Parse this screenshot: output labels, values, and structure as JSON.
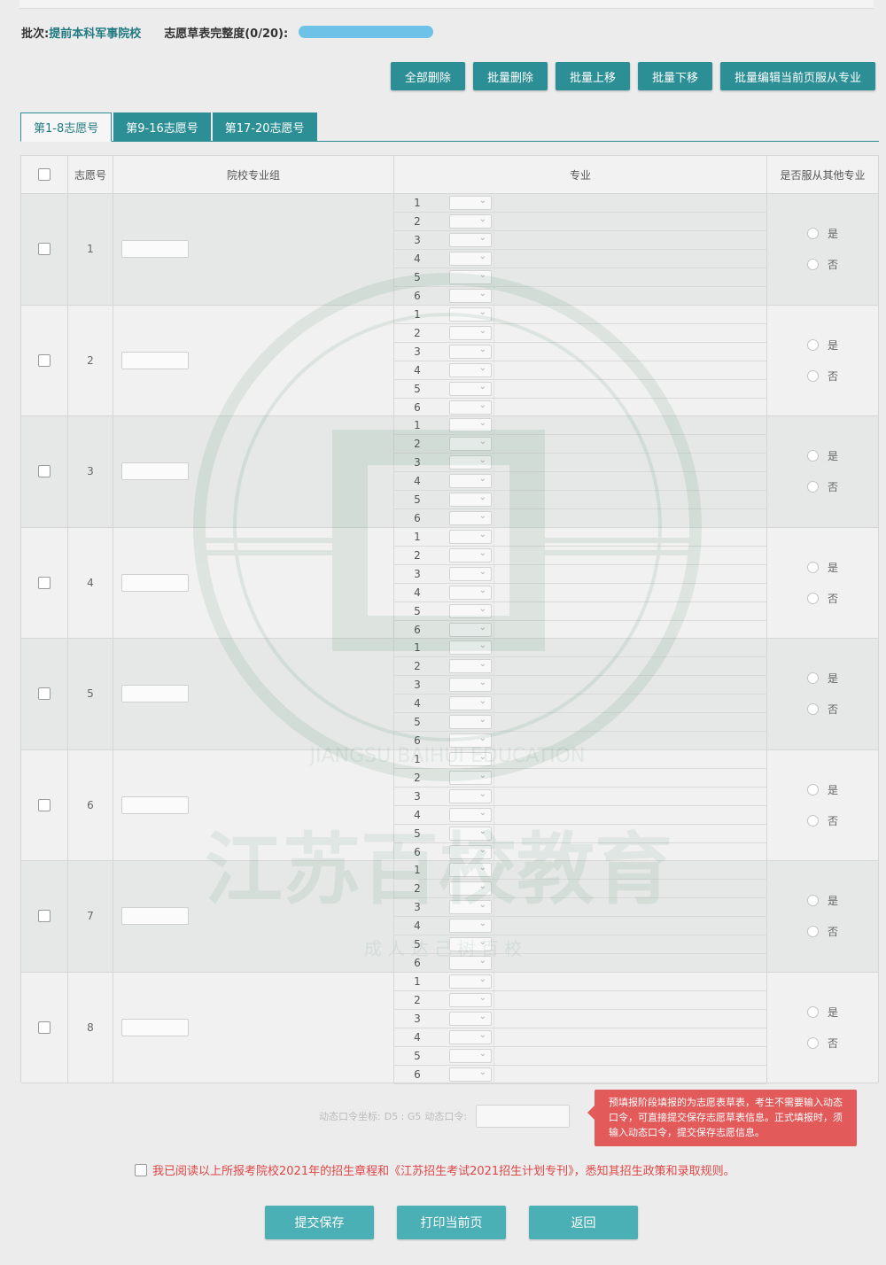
{
  "header": {
    "batch_label": "批次:",
    "batch_value": "提前本科军事院校",
    "completeness_label": "志愿草表完整度(0/20):"
  },
  "actions": [
    "全部删除",
    "批量删除",
    "批量上移",
    "批量下移",
    "批量编辑当前页服从专业"
  ],
  "tabs": [
    {
      "label": "第1-8志愿号",
      "active": true
    },
    {
      "label": "第9-16志愿号",
      "active": false
    },
    {
      "label": "第17-20志愿号",
      "active": false
    }
  ],
  "table": {
    "headers": {
      "select_all": "",
      "no": "志愿号",
      "group": "院校专业组",
      "major": "专业",
      "obey": "是否服从其他专业"
    },
    "rows": [
      {
        "no": "1"
      },
      {
        "no": "2"
      },
      {
        "no": "3"
      },
      {
        "no": "4"
      },
      {
        "no": "5"
      },
      {
        "no": "6"
      },
      {
        "no": "7"
      },
      {
        "no": "8"
      }
    ],
    "major_slots": [
      "1",
      "2",
      "3",
      "4",
      "5",
      "6"
    ],
    "radio_yes": "是",
    "radio_no": "否"
  },
  "token": {
    "label": "动态口令坐标:",
    "coords": "D5 : G5",
    "input_label": "动态口令:"
  },
  "notice": "预填报阶段填报的为志愿表草表，考生不需要输入动态口令，可直接提交保存志愿草表信息。正式填报时，须输入动态口令，提交保存志愿信息。",
  "agreement": "我已阅读以上所报考院校2021年的招生章程和《江苏招生考试2021招生计划专刊》，悉知其招生政策和录取规则。",
  "bottom_buttons": [
    "提交保存",
    "打印当前页",
    "返回"
  ],
  "watermark": {
    "big_text": "江苏百校教育",
    "small_text": "成 人 达 己   树 百 校",
    "ring_text": "JIANGSU BAIHUI EDUCATION"
  },
  "colors": {
    "primary": "#2c8f96",
    "progress": "#6ec2e8",
    "notice": "#e25a5a",
    "agreement": "#e04646"
  }
}
